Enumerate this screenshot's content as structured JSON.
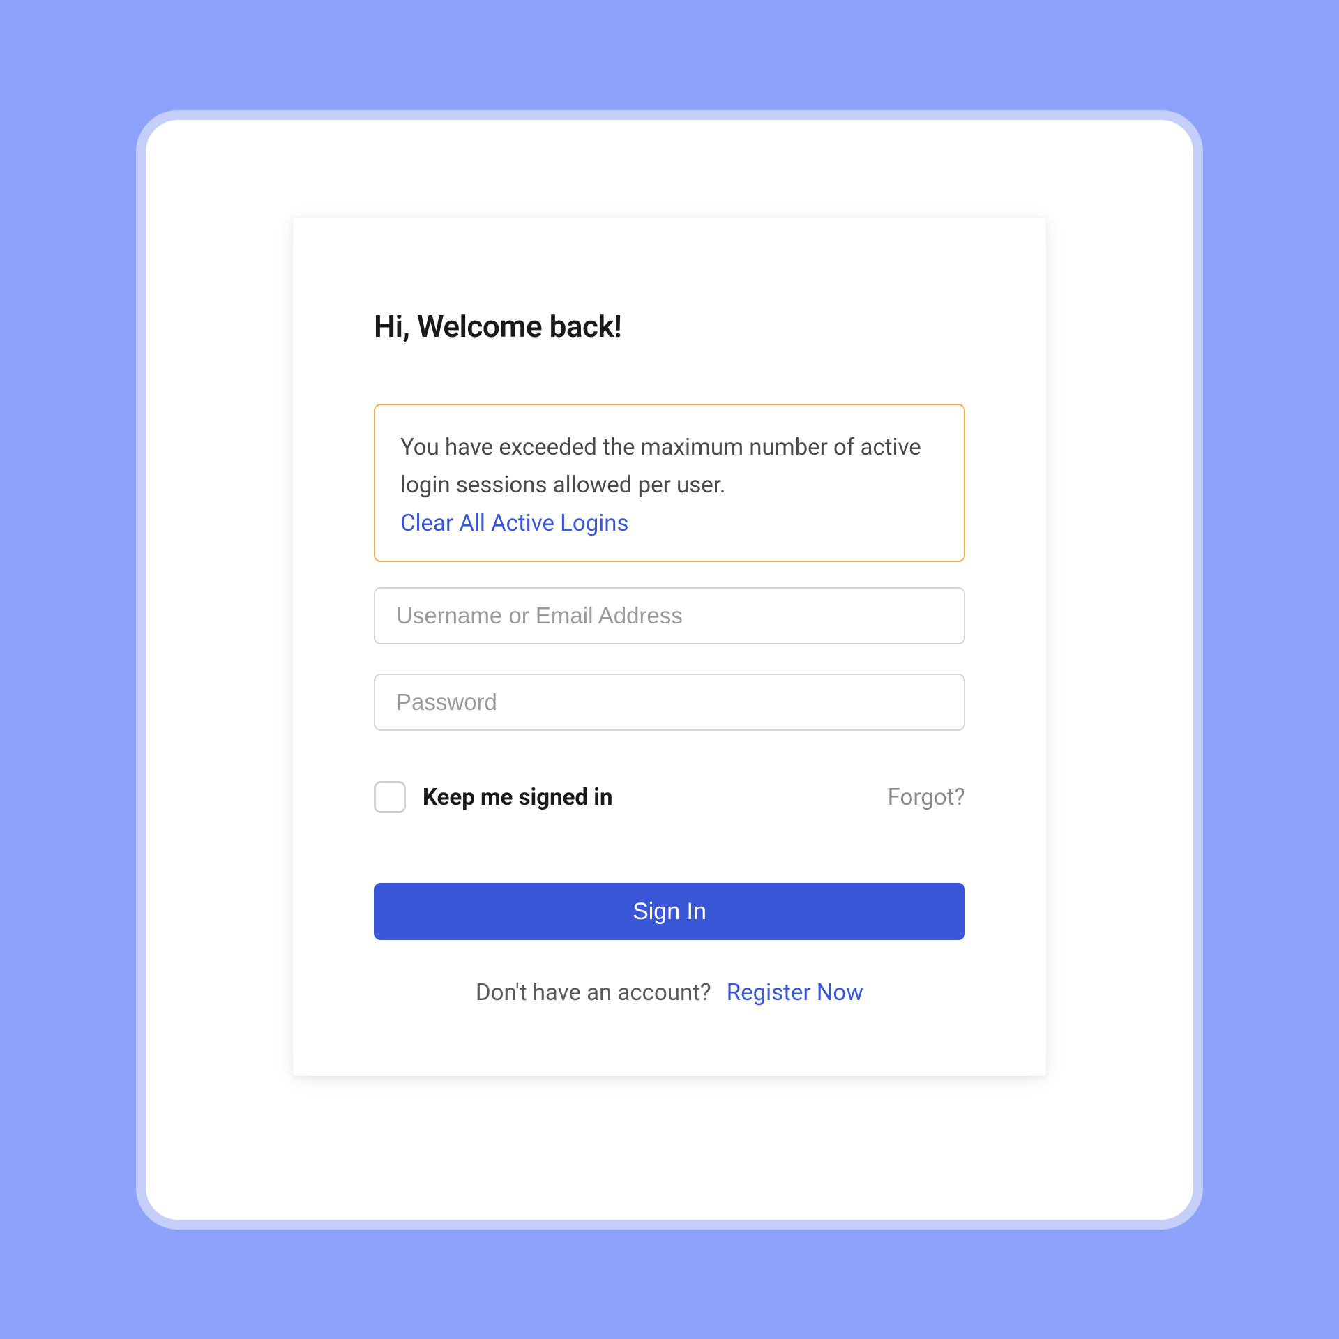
{
  "heading": "Hi, Welcome back!",
  "alert": {
    "message": "You have exceeded the maximum number of active login sessions allowed per user.",
    "action_label": "Clear All Active Logins"
  },
  "form": {
    "username_placeholder": "Username or Email Address",
    "password_placeholder": "Password",
    "keep_signed_in_label": "Keep me signed in",
    "forgot_label": "Forgot?",
    "signin_label": "Sign In"
  },
  "register": {
    "prompt": "Don't have an account?",
    "action_label": "Register Now"
  }
}
